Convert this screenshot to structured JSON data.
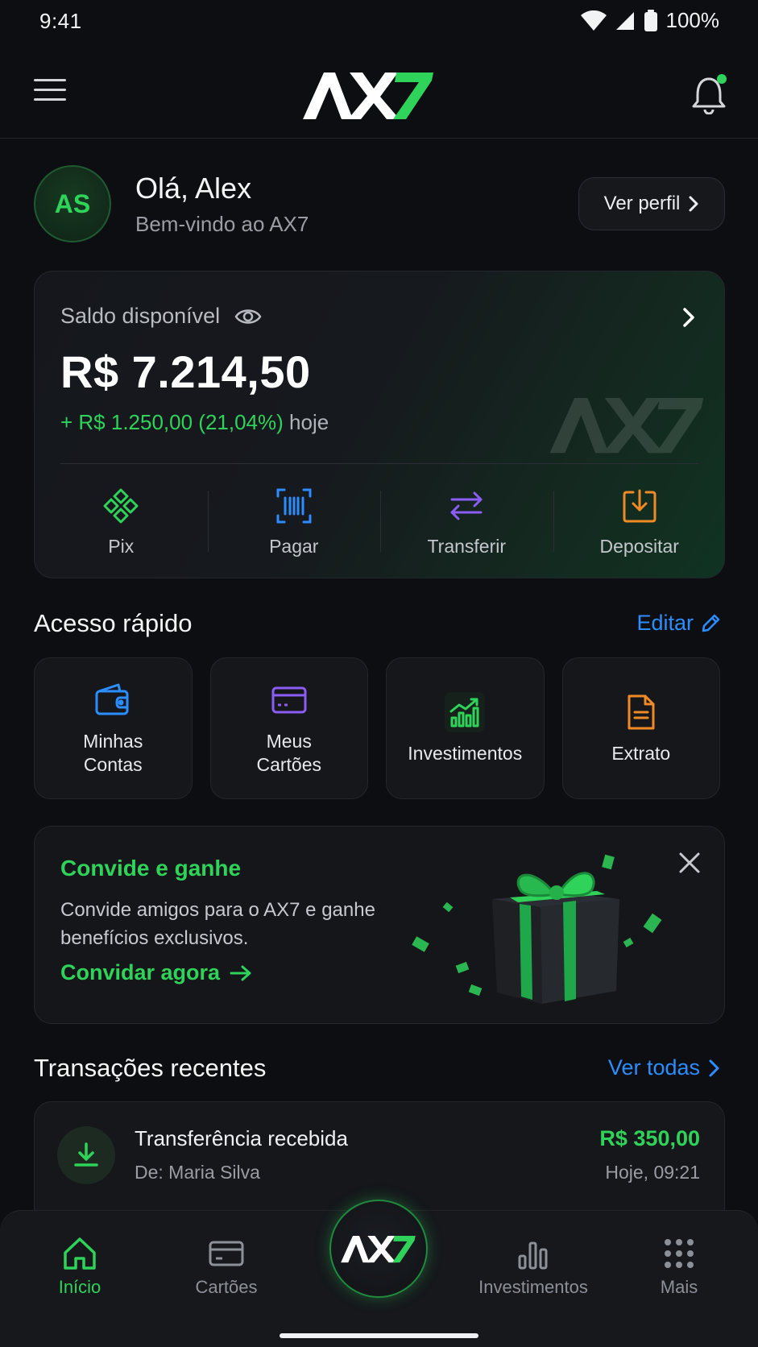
{
  "status_bar": {
    "time": "9:41",
    "battery": "100%"
  },
  "header": {
    "logo_text": "AX7"
  },
  "profile": {
    "initials": "AS",
    "greeting": "Olá, Alex",
    "welcome": "Bem-vindo ao AX7",
    "profile_button": "Ver perfil"
  },
  "balance": {
    "label": "Saldo disponível",
    "value": "R$ 7.214,50",
    "change": "+ R$ 1.250,00 (21,04%)",
    "change_suffix": "hoje",
    "actions": [
      {
        "label": "Pix",
        "icon": "pix-icon"
      },
      {
        "label": "Pagar",
        "icon": "barcode-icon"
      },
      {
        "label": "Transferir",
        "icon": "transfer-icon"
      },
      {
        "label": "Depositar",
        "icon": "deposit-icon"
      }
    ]
  },
  "quick_access": {
    "title": "Acesso rápido",
    "edit_label": "Editar",
    "items": [
      {
        "label": "Minhas\nContas",
        "icon": "wallet-icon"
      },
      {
        "label": "Meus\nCartões",
        "icon": "card-icon"
      },
      {
        "label": "Investimentos",
        "icon": "chart-up-icon"
      },
      {
        "label": "Extrato",
        "icon": "document-icon"
      }
    ]
  },
  "invite": {
    "title": "Convide e ganhe",
    "text": "Convide amigos para o AX7 e ganhe benefícios exclusivos.",
    "cta": "Convidar agora"
  },
  "transactions": {
    "title": "Transações recentes",
    "see_all": "Ver todas",
    "items": [
      {
        "title": "Transferência recebida",
        "subtitle": "De: Maria Silva",
        "amount": "R$ 350,00",
        "date": "Hoje, 09:21"
      }
    ]
  },
  "bottom_nav": {
    "items": [
      {
        "label": "Início",
        "icon": "home-icon",
        "active": true
      },
      {
        "label": "Cartões",
        "icon": "card-icon"
      },
      {
        "label": "Investimentos",
        "icon": "bar-chart-icon"
      },
      {
        "label": "Mais",
        "icon": "grid-icon"
      }
    ],
    "center_logo": "AX7"
  },
  "colors": {
    "accent_green": "#2fd35a",
    "link_blue": "#2b8dff",
    "purple": "#8b5cf6",
    "orange": "#f08a24",
    "background": "#0d0e11"
  }
}
